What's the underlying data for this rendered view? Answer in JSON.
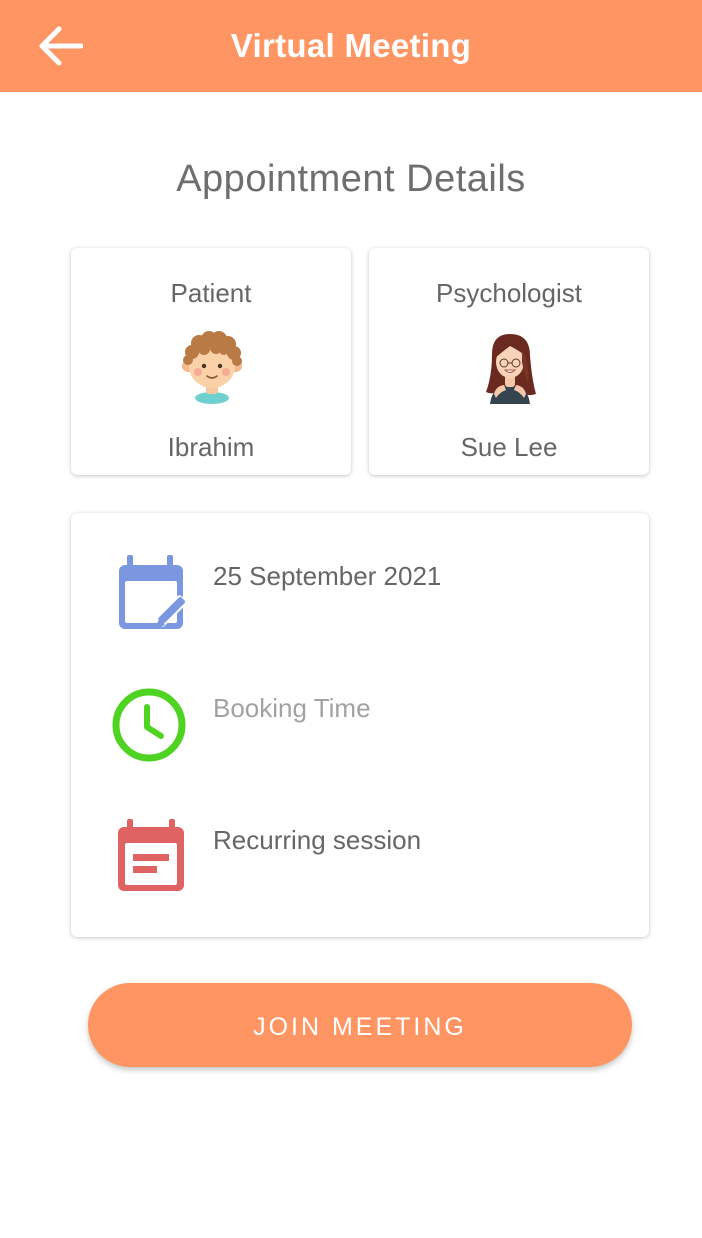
{
  "header": {
    "title": "Virtual Meeting",
    "back_icon": "arrow-left-icon",
    "background": "#ff9563"
  },
  "page": {
    "section_title": "Appointment Details"
  },
  "participants": [
    {
      "role": "Patient",
      "name": "Ibrahim",
      "avatar": "boy-avatar"
    },
    {
      "role": "Psychologist",
      "name": "Sue Lee",
      "avatar": "woman-avatar"
    }
  ],
  "details": {
    "date": {
      "text": "25 September 2021",
      "icon": "calendar-edit-icon",
      "color": "#7b97e0"
    },
    "time": {
      "text": "Booking Time",
      "icon": "clock-icon",
      "color": "#4fd321"
    },
    "recurrence": {
      "text": "Recurring session",
      "icon": "calendar-event-icon",
      "color": "#e06363"
    }
  },
  "actions": {
    "join_label": "JOIN MEETING"
  }
}
